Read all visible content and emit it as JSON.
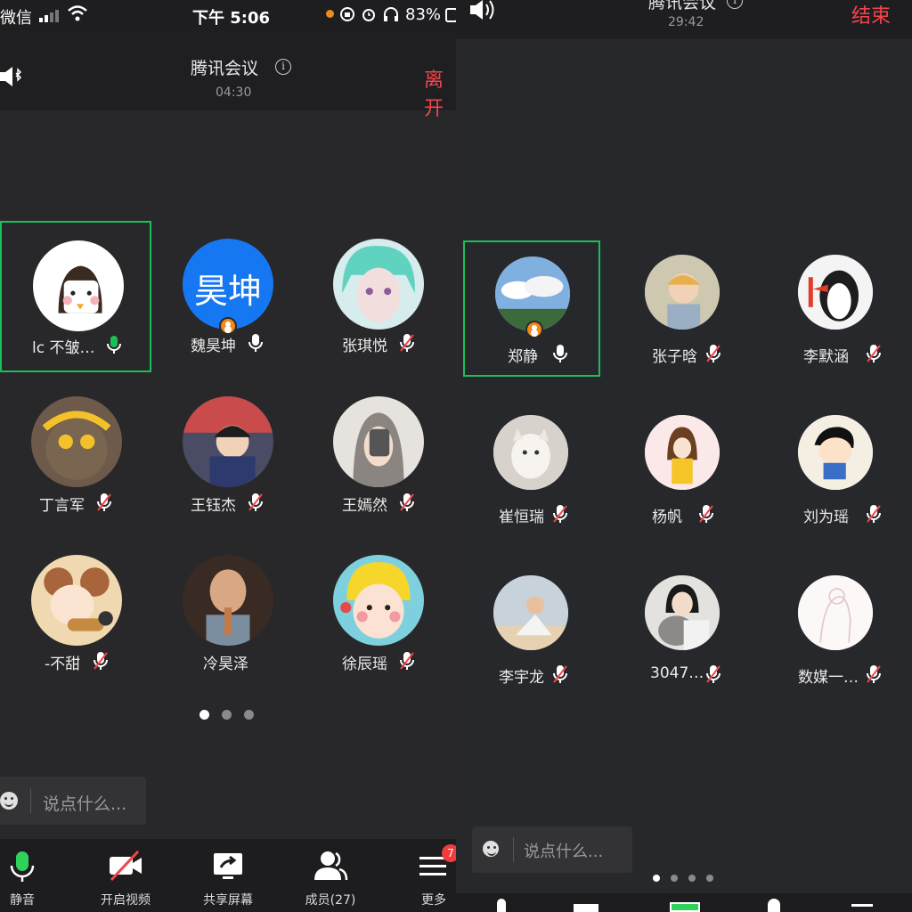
{
  "status_bar": {
    "carrier": "微信",
    "time": "下午 5:06",
    "battery": "83%"
  },
  "left_meeting": {
    "title": "腾讯会议",
    "timer": "04:30",
    "leave_label": "离开",
    "participants": [
      {
        "name": "lc 不皱…",
        "mic": "on-active"
      },
      {
        "name": "魏昊坤",
        "mic": "on",
        "avatar_text": "昊坤",
        "host": true
      },
      {
        "name": "张琪悦",
        "mic": "muted"
      },
      {
        "name": "丁言军",
        "mic": "muted"
      },
      {
        "name": "王钰杰",
        "mic": "muted"
      },
      {
        "name": "王嫣然",
        "mic": "muted"
      },
      {
        "name": "-不甜",
        "mic": "muted"
      },
      {
        "name": "冷昊泽",
        "mic": "none"
      },
      {
        "name": "徐辰瑶",
        "mic": "muted"
      }
    ],
    "chat_placeholder": "说点什么...",
    "toolbar": [
      {
        "label": "静音",
        "icon": "mic-icon"
      },
      {
        "label": "开启视频",
        "icon": "video-off-icon"
      },
      {
        "label": "共享屏幕",
        "icon": "share-screen-icon"
      },
      {
        "label": "成员(27)",
        "icon": "members-icon"
      },
      {
        "label": "更多",
        "icon": "more-icon",
        "badge": "7"
      }
    ]
  },
  "right_meeting": {
    "title": "腾讯会议",
    "timer": "29:42",
    "end_label": "结束",
    "participants": [
      {
        "name": "郑静",
        "mic": "on",
        "host": true
      },
      {
        "name": "张子晗",
        "mic": "muted"
      },
      {
        "name": "李默涵",
        "mic": "muted"
      },
      {
        "name": "崔恒瑞",
        "mic": "muted"
      },
      {
        "name": "杨帆",
        "mic": "muted"
      },
      {
        "name": "刘为瑶",
        "mic": "muted"
      },
      {
        "name": "李宇龙",
        "mic": "muted"
      },
      {
        "name": "3047…",
        "mic": "muted"
      },
      {
        "name": "数媒一…",
        "mic": "muted"
      }
    ],
    "chat_placeholder": "说点什么..."
  },
  "colors": {
    "active_green": "#1bbf5a",
    "leave_red": "#f2454b",
    "host_orange": "#f0881a",
    "badge_red": "#f03c3c",
    "avatar_blue": "#1677f2"
  }
}
